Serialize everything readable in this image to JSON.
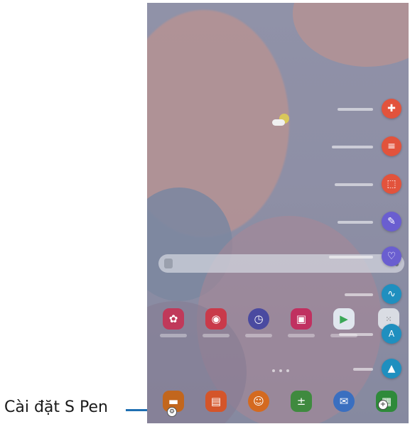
{
  "callout": {
    "label": "Cài đặt S Pen",
    "line_color": "#1f6fb2"
  },
  "status": {
    "weather_icon": "partly-cloudy-icon"
  },
  "home": {
    "page_indicator_count": 3,
    "apps": [
      {
        "icon": "flower-icon",
        "color": "#c0395a"
      },
      {
        "icon": "camera-icon",
        "color": "#c93a4a"
      },
      {
        "icon": "clock-icon",
        "color": "#4a4aa0"
      },
      {
        "icon": "store-bag-icon",
        "color": "#c03060"
      },
      {
        "icon": "play-store-icon",
        "color": "#e0e6ee"
      },
      {
        "icon": "apps-grid-icon",
        "color": "#d9dce3"
      }
    ],
    "dock": [
      {
        "icon": "folder-icon",
        "color": "#c2661d"
      },
      {
        "icon": "notes-icon",
        "color": "#d4552a"
      },
      {
        "icon": "contacts-icon",
        "color": "#d46a20"
      },
      {
        "icon": "calculator-icon",
        "color": "#3f8a3f"
      },
      {
        "icon": "messages-icon",
        "color": "#3a6fc0"
      },
      {
        "icon": "calendar-icon",
        "color": "#2e8a3a"
      }
    ]
  },
  "air_command": {
    "items": [
      {
        "icon": "create-note-icon",
        "color": "#e2533c"
      },
      {
        "icon": "view-notes-icon",
        "color": "#e2533c"
      },
      {
        "icon": "smart-select-icon",
        "color": "#e2533c"
      },
      {
        "icon": "screen-write-icon",
        "color": "#6a5ed0"
      },
      {
        "icon": "live-message-icon",
        "color": "#6a5ed0"
      },
      {
        "icon": "ar-doodle-icon",
        "color": "#1f8fbf"
      },
      {
        "icon": "translate-icon",
        "color": "#1f8fbf"
      },
      {
        "icon": "bixby-vision-icon",
        "color": "#1f8fbf"
      }
    ],
    "settings_icon": "gear-icon",
    "add_icon": "plus-icon"
  }
}
